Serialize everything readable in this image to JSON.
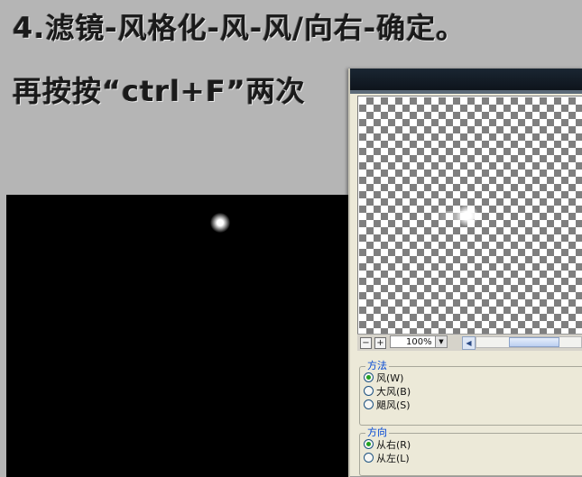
{
  "tutorial": {
    "step_line": "4.滤镜-风格化-风-风/向右-确定。",
    "repeat_line": "再按按“ctrl+F”两次"
  },
  "dialog": {
    "zoom": {
      "value": "100%",
      "minus_glyph": "−",
      "plus_glyph": "+",
      "dropdown_glyph": "▼",
      "scroll_left_glyph": "◀"
    },
    "method": {
      "legend": "方法",
      "options": [
        {
          "label": "风",
          "key": "(W)",
          "selected": true
        },
        {
          "label": "大风",
          "key": "(B)",
          "selected": false
        },
        {
          "label": "飓风",
          "key": "(S)",
          "selected": false
        }
      ]
    },
    "direction": {
      "legend": "方向",
      "options": [
        {
          "label": "从右",
          "key": "(R)",
          "selected": true
        },
        {
          "label": "从左",
          "key": "(L)",
          "selected": false
        }
      ]
    }
  },
  "colors": {
    "accent_blue": "#0046d5",
    "radio_selected": "#21a121",
    "canvas_background": "#000000",
    "page_background": "#b5b5b5"
  }
}
